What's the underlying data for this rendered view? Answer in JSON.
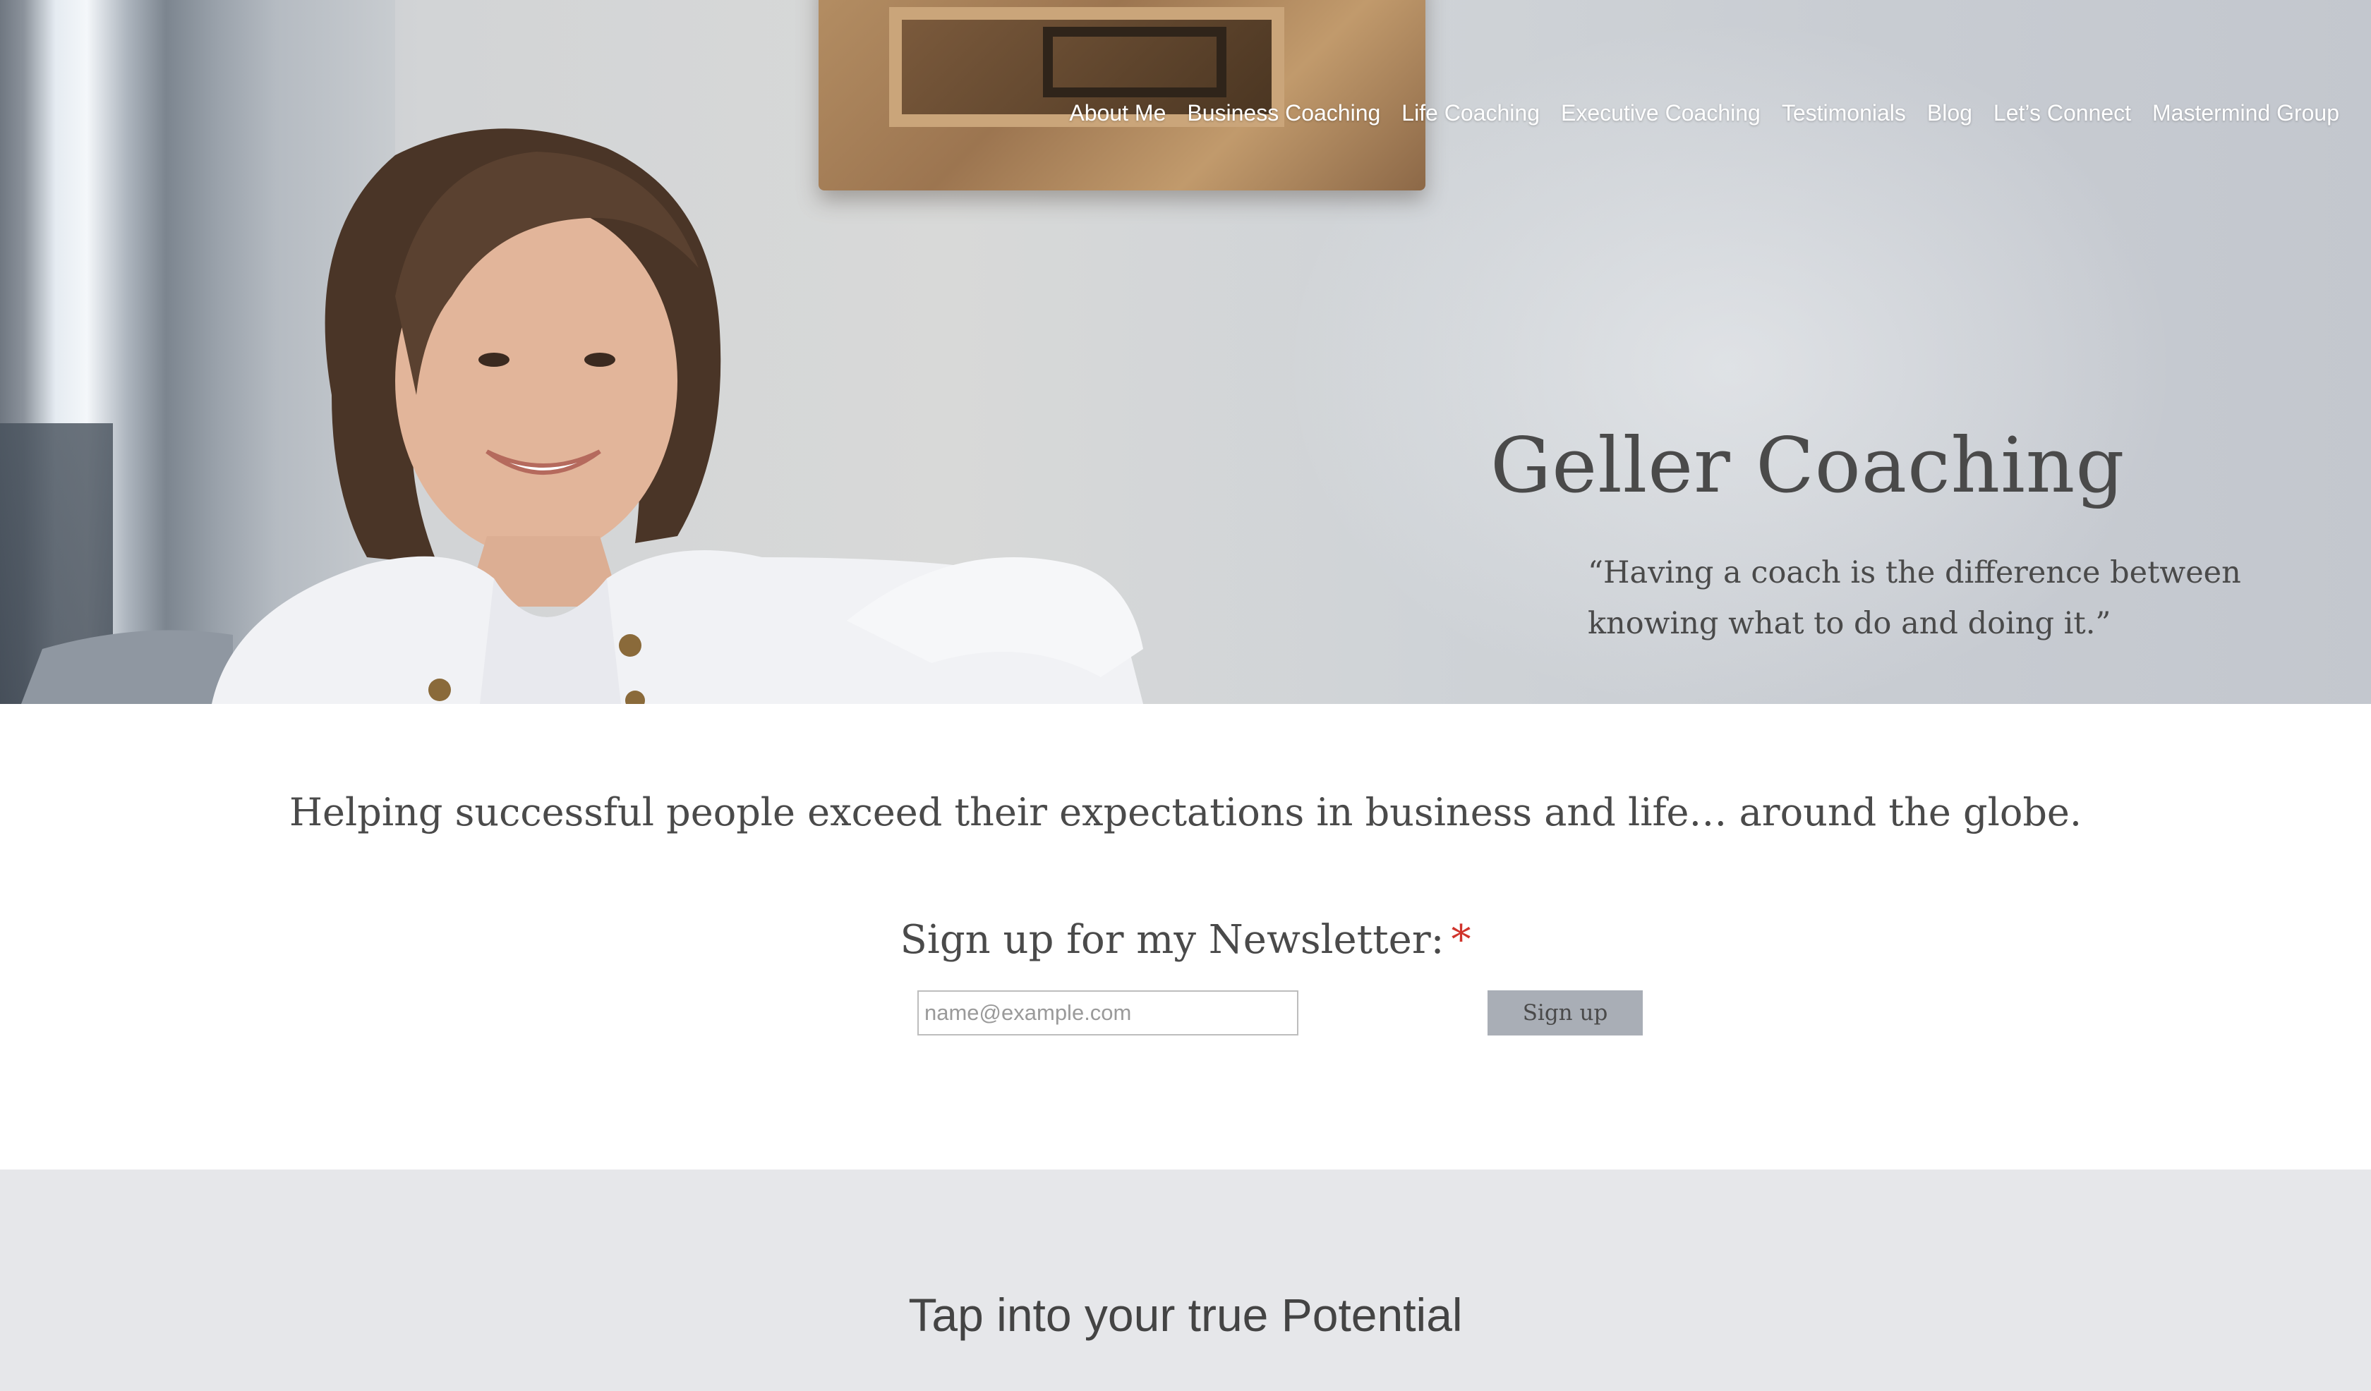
{
  "nav": {
    "items": [
      {
        "label": "About Me"
      },
      {
        "label": "Business Coaching"
      },
      {
        "label": "Life Coaching"
      },
      {
        "label": "Executive Coaching"
      },
      {
        "label": "Testimonials"
      },
      {
        "label": "Blog"
      },
      {
        "label": "Let’s Connect"
      },
      {
        "label": "Mastermind Group"
      }
    ]
  },
  "hero": {
    "title": "Geller Coaching",
    "quote": "“Having a coach is the difference between knowing what to do and doing it.”"
  },
  "main": {
    "tagline": "Helping successful people exceed their expectations in business and life… around the globe."
  },
  "newsletter": {
    "label": "Sign up for my Newsletter:",
    "required_mark": "*",
    "email_placeholder": "name@example.com",
    "email_value": "",
    "button_label": "Sign up"
  },
  "section": {
    "heading": "Tap into your true Potential"
  },
  "colors": {
    "text": "#4a4a4a",
    "nav_text": "#ffffff",
    "button_bg": "#a9aeb6",
    "required": "#d0342c",
    "grey_section": "#e6e7ea"
  }
}
